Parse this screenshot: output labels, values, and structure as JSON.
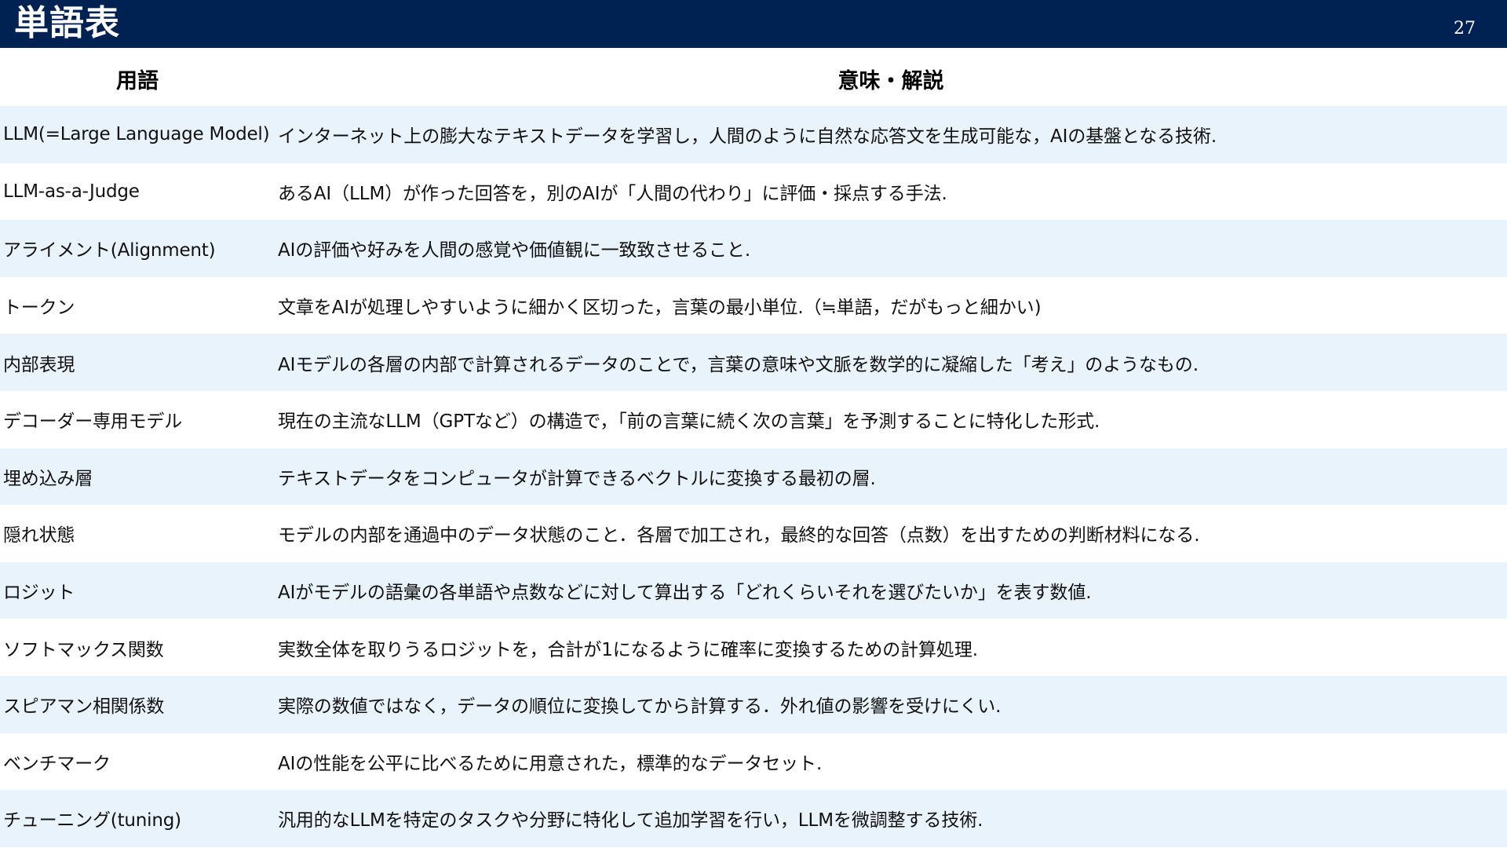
{
  "header": {
    "title": "単語表",
    "page_number": "27"
  },
  "table": {
    "columns": [
      "用語",
      "意味・解説"
    ],
    "rows": [
      {
        "term": "LLM(=Large Language Model)",
        "description": "インターネット上の膨大なテキストデータを学習し，人間のように自然な応答文を生成可能な，AIの基盤となる技術."
      },
      {
        "term": "LLM-as-a-Judge",
        "description": "あるAI（LLM）が作った回答を，別のAIが「人間の代わり」に評価・採点する手法."
      },
      {
        "term": "アライメント(Alignment)",
        "description": "AIの評価や好みを人間の感覚や価値観に一致致させること."
      },
      {
        "term": "トークン",
        "description": "文章をAIが処理しやすいように細かく区切った，言葉の最小単位.（≒単語，だがもっと細かい)"
      },
      {
        "term": "内部表現",
        "description": "AIモデルの各層の内部で計算されるデータのことで，言葉の意味や文脈を数学的に凝縮した「考え」のようなもの."
      },
      {
        "term": "デコーダー専用モデル",
        "description": "現在の主流なLLM（GPTなど）の構造で，「前の言葉に続く次の言葉」を予測することに特化した形式."
      },
      {
        "term": "埋め込み層",
        "description": "テキストデータをコンピュータが計算できるベクトルに変換する最初の層."
      },
      {
        "term": "隠れ状態",
        "description": "モデルの内部を通過中のデータ状態のこと．各層で加工され，最終的な回答（点数）を出すための判断材料になる."
      },
      {
        "term": "ロジット",
        "description": "AIがモデルの語彙の各単語や点数などに対して算出する「どれくらいそれを選びたいか」を表す数値."
      },
      {
        "term": "ソフトマックス関数",
        "description": "実数全体を取りうるロジットを，合計が1になるように確率に変換するための計算処理."
      },
      {
        "term": "スピアマン相関係数",
        "description": "実際の数値ではなく，データの順位に変換してから計算する．外れ値の影響を受けにくい."
      },
      {
        "term": "ベンチマーク",
        "description": "AIの性能を公平に比べるために用意された，標準的なデータセット."
      },
      {
        "term": "チューニング(tuning)",
        "description": "汎用的なLLMを特定のタスクや分野に特化して追加学習を行い，LLMを微調整する技術."
      }
    ]
  }
}
